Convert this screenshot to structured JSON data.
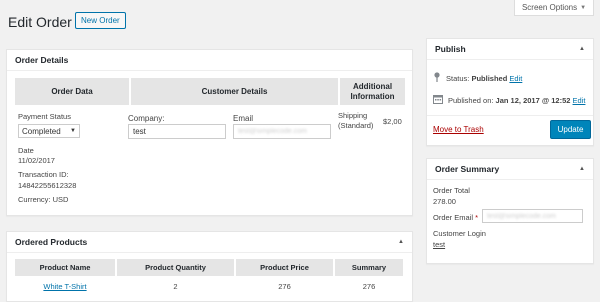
{
  "screen_options": {
    "label": "Screen Options"
  },
  "header": {
    "title": "Edit Order",
    "new_order_label": "New Order"
  },
  "order_details": {
    "title": "Order Details",
    "columns": [
      "Order Data",
      "Customer Details",
      "Additional Information"
    ],
    "payment_status_label": "Payment Status",
    "payment_status_value": "Completed",
    "date_label": "Date",
    "date_value": "11/02/2017",
    "transaction_label": "Transaction ID:",
    "transaction_value": "14842255612328",
    "currency": "Currency: USD",
    "company_label": "Company:",
    "company_value": "test",
    "email_label": "Email",
    "email_value": "test@simplecode.com",
    "shipping_label": "Shipping (Standard)",
    "shipping_value": "$2,00"
  },
  "ordered_products": {
    "title": "Ordered Products",
    "columns": [
      "Product Name",
      "Product Quantity",
      "Product Price",
      "Summary"
    ],
    "rows": [
      {
        "name": "White T-Shirt",
        "quantity": "2",
        "price": "276",
        "summary": "276"
      }
    ]
  },
  "publish": {
    "title": "Publish",
    "status_label": "Status:",
    "status_value": "Published",
    "status_edit": "Edit",
    "published_label": "Published on:",
    "published_value": "Jan 12, 2017 @ 12:52",
    "published_edit": "Edit",
    "trash_label": "Move to Trash",
    "update_label": "Update"
  },
  "summary": {
    "title": "Order Summary",
    "total_label": "Order Total",
    "total_value": "278.00",
    "email_label": "Order Email",
    "email_required": "*",
    "email_value": "test@simplecode.com",
    "login_label": "Customer Login",
    "login_value": "test"
  }
}
